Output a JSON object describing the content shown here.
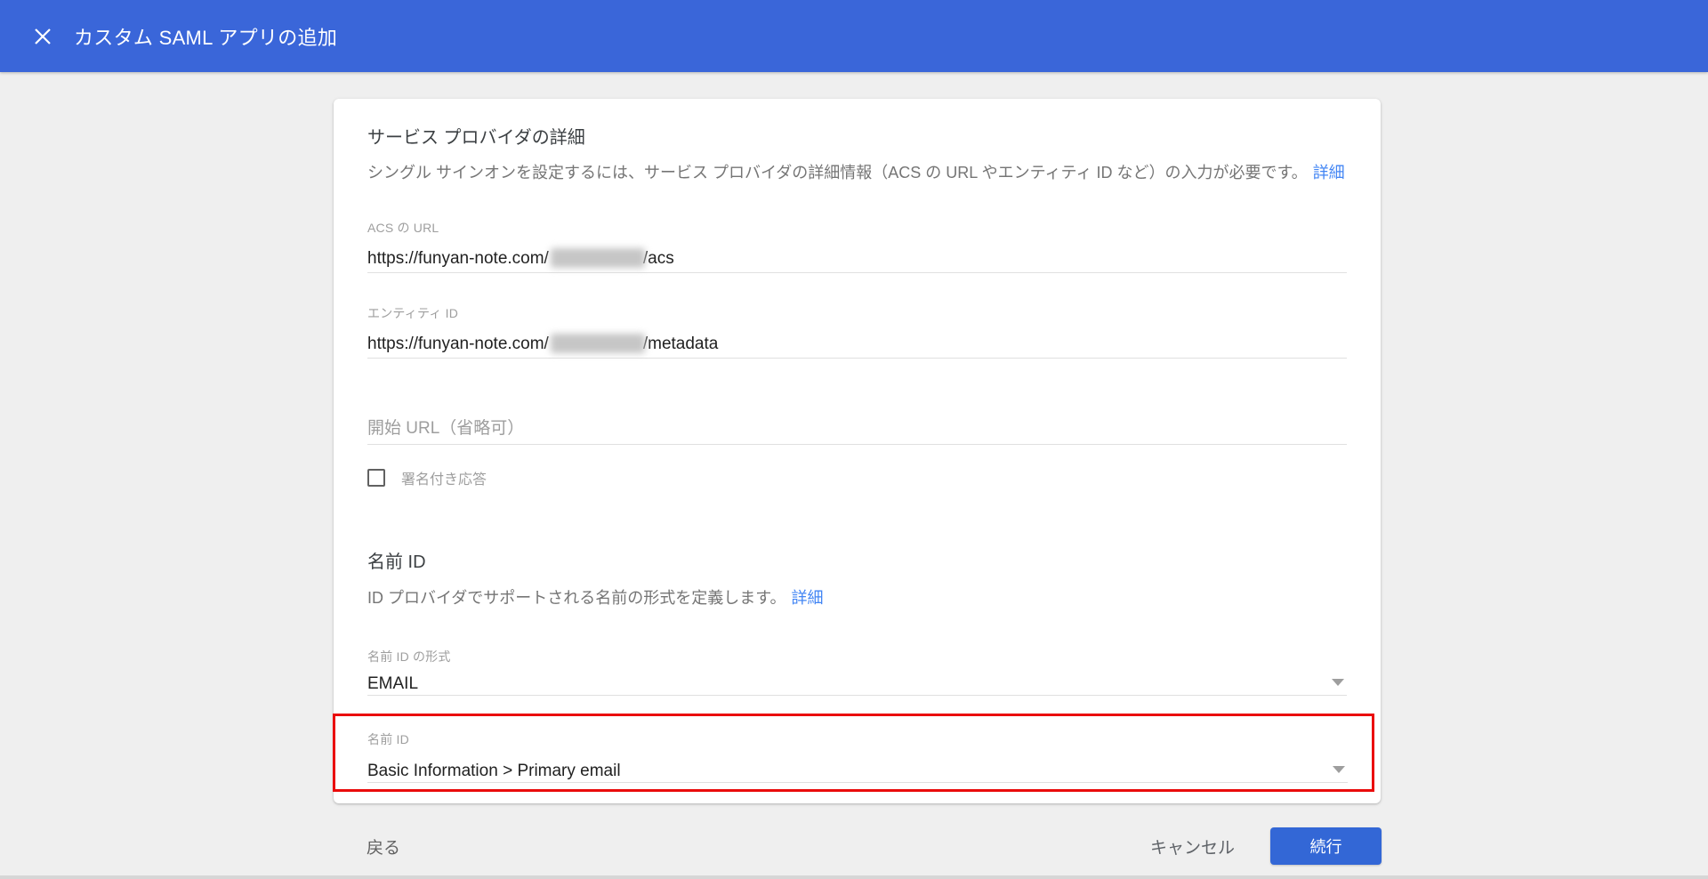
{
  "header": {
    "title": "カスタム SAML アプリの追加"
  },
  "service_provider": {
    "heading": "サービス プロバイダの詳細",
    "description": "シングル サインオンを設定するには、サービス プロバイダの詳細情報（ACS の URL やエンティティ ID など）の入力が必要です。",
    "learn_more_label": "詳細",
    "acs_url": {
      "label": "ACS の URL",
      "value_prefix": "https://funyan-note.com/",
      "value_redacted": "[ぼかし]",
      "value_suffix": "/acs"
    },
    "entity_id": {
      "label": "エンティティ ID",
      "value_prefix": "https://funyan-note.com/",
      "value_redacted": "[ぼかし]",
      "value_suffix": "/metadata"
    },
    "start_url": {
      "placeholder": "開始 URL（省略可）",
      "value": ""
    },
    "signed_response": {
      "label": "署名付き応答",
      "checked": false
    }
  },
  "name_id": {
    "heading": "名前 ID",
    "description": "ID プロバイダでサポートされる名前の形式を定義します。",
    "learn_more_label": "詳細",
    "format": {
      "label": "名前 ID の形式",
      "value": "EMAIL"
    },
    "value_field": {
      "label": "名前 ID",
      "value": "Basic Information > Primary email",
      "highlighted": true
    }
  },
  "footer": {
    "back_label": "戻る",
    "cancel_label": "キャンセル",
    "continue_label": "続行"
  },
  "colors": {
    "header_blue": "#3a66d9",
    "button_blue": "#3367d6",
    "link_blue": "#4285f4",
    "highlight_red": "#ea0b0b",
    "background_gray": "#efefef"
  }
}
